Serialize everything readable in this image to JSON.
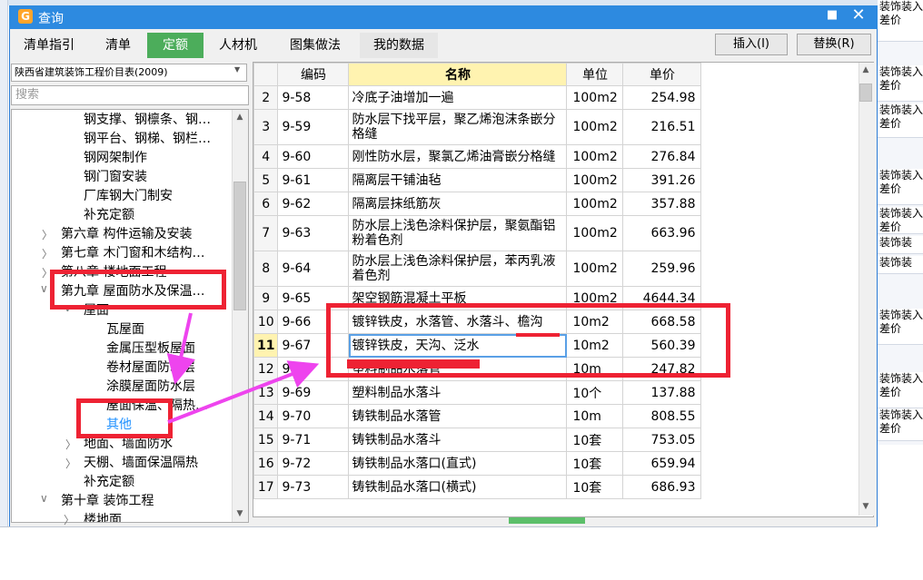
{
  "window": {
    "title": "查询",
    "maximize_glyph": "■",
    "close_glyph": "✕"
  },
  "tabs": [
    {
      "label": "清单指引"
    },
    {
      "label": "清单"
    },
    {
      "label": "定额"
    },
    {
      "label": "人材机"
    },
    {
      "label": "图集做法"
    },
    {
      "label": "我的数据"
    }
  ],
  "buttons": {
    "insert": "插入(I)",
    "replace": "替换(R)"
  },
  "left": {
    "library": "陕西省建筑装饰工程价目表(2009)",
    "search_placeholder": "搜索",
    "tree": [
      {
        "label": "钢支撑、钢檩条、钢…"
      },
      {
        "label": "钢平台、钢梯、钢栏…"
      },
      {
        "label": "钢网架制作"
      },
      {
        "label": "钢门窗安装"
      },
      {
        "label": "厂库钢大门制安"
      },
      {
        "label": "补充定额"
      },
      {
        "label": "第六章  构件运输及安装"
      },
      {
        "label": "第七章  木门窗和木结构…"
      },
      {
        "label": "第八章  楼地面工程"
      },
      {
        "label": "第九章  屋面防水及保温…"
      },
      {
        "label": "屋面"
      },
      {
        "label": "瓦屋面"
      },
      {
        "label": "金属压型板屋面"
      },
      {
        "label": "卷材屋面防水层"
      },
      {
        "label": "涂膜屋面防水层"
      },
      {
        "label": "屋面保温、隔热…"
      },
      {
        "label": "其他"
      },
      {
        "label": "地面、墙面防水"
      },
      {
        "label": "天棚、墙面保温隔热"
      },
      {
        "label": "补充定额"
      },
      {
        "label": "第十章  装饰工程"
      },
      {
        "label": "楼地面"
      }
    ]
  },
  "grid": {
    "headers": {
      "code": "编码",
      "name": "名称",
      "unit": "单位",
      "price": "单价"
    },
    "rows": [
      {
        "no": "2",
        "code": "9-58",
        "name": "冷底子油增加一遍",
        "unit": "100m2",
        "price": "254.98"
      },
      {
        "no": "3",
        "code": "9-59",
        "name": "防水层下找平层，聚乙烯泡沫条嵌分格缝",
        "unit": "100m2",
        "price": "216.51"
      },
      {
        "no": "4",
        "code": "9-60",
        "name": "刚性防水层，聚氯乙烯油膏嵌分格缝",
        "unit": "100m2",
        "price": "276.84"
      },
      {
        "no": "5",
        "code": "9-61",
        "name": "隔离层干铺油毡",
        "unit": "100m2",
        "price": "391.26"
      },
      {
        "no": "6",
        "code": "9-62",
        "name": "隔离层抹纸筋灰",
        "unit": "100m2",
        "price": "357.88"
      },
      {
        "no": "7",
        "code": "9-63",
        "name": "防水层上浅色涂料保护层，聚氨酯铝粉着色剂",
        "unit": "100m2",
        "price": "663.96"
      },
      {
        "no": "8",
        "code": "9-64",
        "name": "防水层上浅色涂料保护层，苯丙乳液着色剂",
        "unit": "100m2",
        "price": "259.96"
      },
      {
        "no": "9",
        "code": "9-65",
        "name": "架空钢筋混凝土平板",
        "unit": "100m2",
        "price": "4644.34"
      },
      {
        "no": "10",
        "code": "9-66",
        "name": "镀锌铁皮，水落管、水落斗、檐沟",
        "unit": "10m2",
        "price": "668.58"
      },
      {
        "no": "11",
        "code": "9-67",
        "name": "镀锌铁皮，天沟、泛水",
        "unit": "10m2",
        "price": "560.39"
      },
      {
        "no": "12",
        "code": "9-68",
        "name": "塑料制品水落管",
        "unit": "10m",
        "price": "247.82"
      },
      {
        "no": "13",
        "code": "9-69",
        "name": "塑料制品水落斗",
        "unit": "10个",
        "price": "137.88"
      },
      {
        "no": "14",
        "code": "9-70",
        "name": "铸铁制品水落管",
        "unit": "10m",
        "price": "808.55"
      },
      {
        "no": "15",
        "code": "9-71",
        "name": "铸铁制品水落斗",
        "unit": "10套",
        "price": "753.05"
      },
      {
        "no": "16",
        "code": "9-72",
        "name": "铸铁制品水落口(直式)",
        "unit": "10套",
        "price": "659.94"
      },
      {
        "no": "17",
        "code": "9-73",
        "name": "铸铁制品水落口(横式)",
        "unit": "10套",
        "price": "686.93"
      }
    ]
  },
  "background_right": [
    "装饰装入差价",
    "装饰装入差价",
    "装饰装入差价",
    "装饰装入差价",
    "装饰装入差价",
    "装饰装",
    "装饰装",
    "装饰装入差价",
    "装饰装入差价",
    "装饰装入差价"
  ],
  "colors": {
    "accent": "#2d8ae0",
    "active_tab": "#4cad5b",
    "annotation": "#ee2233",
    "arrow": "#ee44ee",
    "selected_row_header": "#fff3b0"
  }
}
